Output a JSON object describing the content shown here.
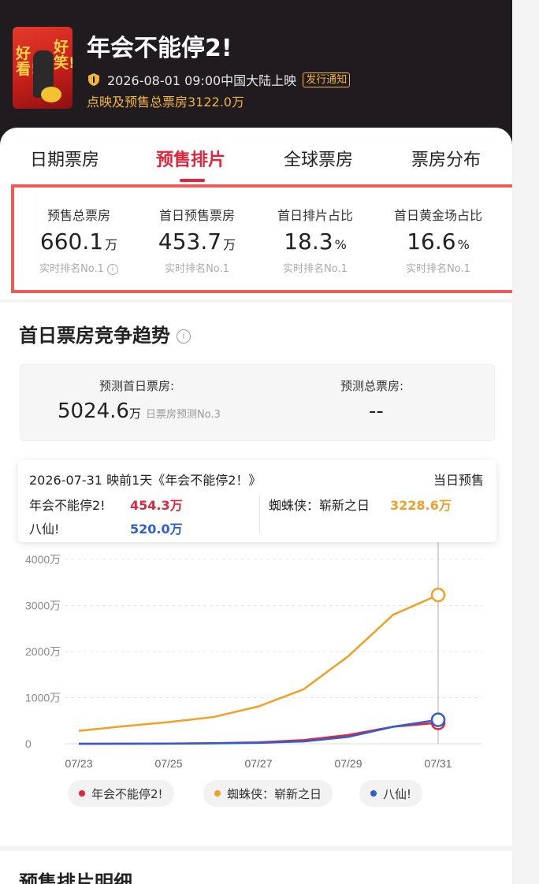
{
  "header": {
    "title": "年会不能停2!",
    "release": "2026-08-01 09:00中国大陆上映",
    "notice_tag": "发行通知",
    "presale_total": "点映及预售总票房3122.0万",
    "poster_text_left": "好看!",
    "poster_text_right": "好笑!"
  },
  "tabs": [
    {
      "label": "日期票房",
      "active": false
    },
    {
      "label": "预售排片",
      "active": true
    },
    {
      "label": "全球票房",
      "active": false
    },
    {
      "label": "票房分布",
      "active": false
    }
  ],
  "stats": [
    {
      "label": "预售总票房",
      "value": "660.1",
      "unit": "万",
      "rank": "实时排名No.1",
      "info": true
    },
    {
      "label": "首日预售票房",
      "value": "453.7",
      "unit": "万",
      "rank": "实时排名No.1",
      "info": false
    },
    {
      "label": "首日排片占比",
      "value": "18.3",
      "unit": "%",
      "rank": "实时排名No.1",
      "info": false
    },
    {
      "label": "首日黄金场占比",
      "value": "16.6",
      "unit": "%",
      "rank": "实时排名No.1",
      "info": false
    }
  ],
  "trend": {
    "title": "首日票房竞争趋势",
    "info_icon": "ⓘ",
    "predict": {
      "first_day_label": "预测首日票房:",
      "first_day_value": "5024.6",
      "first_day_unit": "万",
      "first_day_rank": "日票房预测No.3",
      "total_label": "预测总票房:",
      "total_value": "--"
    },
    "tooltip": {
      "date_line": "2026-07-31  映前1天《年会不能停2！》",
      "right_label": "当日预售",
      "items": [
        {
          "name": "年会不能停2!",
          "value": "454.3万"
        },
        {
          "name": "蜘蛛侠：崭新之日",
          "value": "3228.6万"
        },
        {
          "name": "八仙!",
          "value": "520.0万"
        }
      ]
    }
  },
  "chart_data": {
    "type": "line",
    "x": [
      "07/23",
      "07/24",
      "07/25",
      "07/26",
      "07/27",
      "07/28",
      "07/29",
      "07/30",
      "07/31"
    ],
    "x_tick_labels": [
      "07/23",
      "07/25",
      "07/27",
      "07/29",
      "07/31"
    ],
    "y_tick_labels": [
      "0",
      "1000万",
      "2000万",
      "3000万",
      "4000万"
    ],
    "ylim": [
      0,
      4000
    ],
    "grid": true,
    "legend_position": "bottom",
    "highlight_x": "07/31",
    "series": [
      {
        "name": "年会不能停2!",
        "color": "#e0253c",
        "values": [
          0,
          2,
          5,
          12,
          30,
          80,
          190,
          370,
          454.3
        ]
      },
      {
        "name": "蜘蛛侠：崭新之日",
        "color": "#f0a026",
        "values": [
          280,
          380,
          470,
          580,
          810,
          1180,
          1900,
          2800,
          3228.6
        ]
      },
      {
        "name": "八仙!",
        "color": "#2d5fd1",
        "values": [
          0,
          1,
          3,
          8,
          20,
          50,
          150,
          370,
          520.0
        ]
      }
    ]
  },
  "detail": {
    "title": "预售排片明细"
  }
}
